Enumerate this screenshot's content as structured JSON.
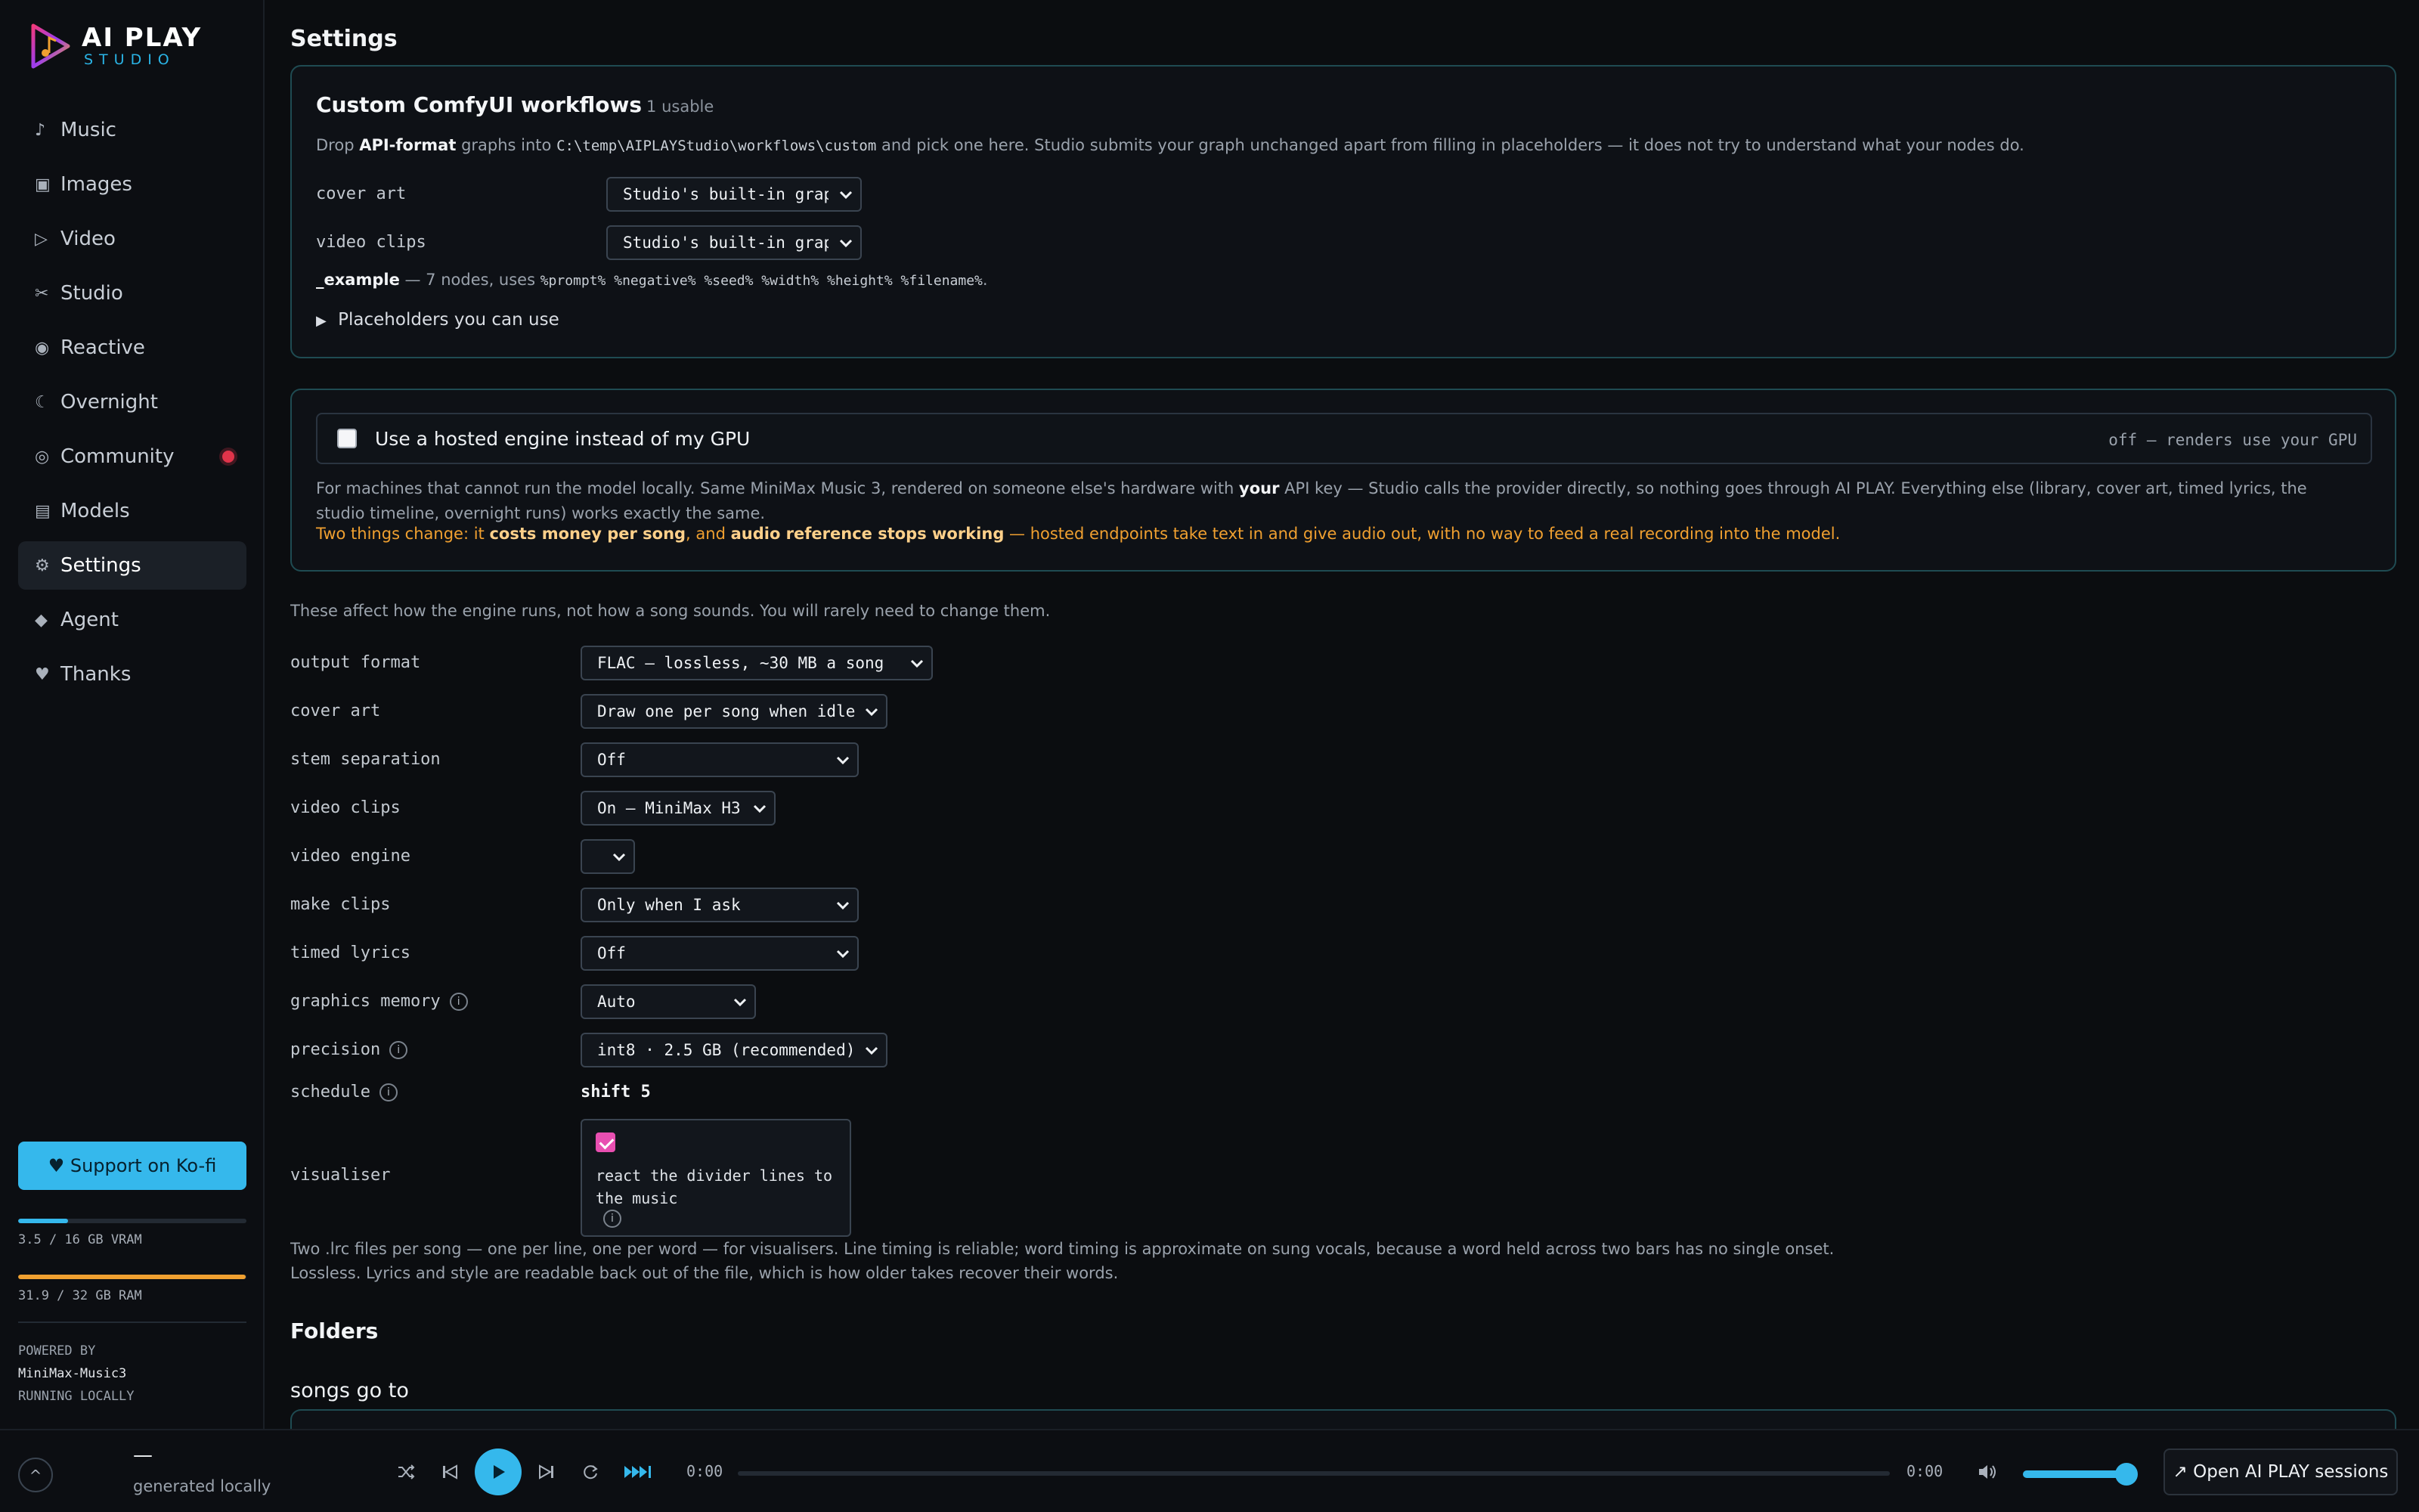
{
  "brand": {
    "title": "AI PLAY",
    "subtitle": "STUDIO"
  },
  "sidebar": {
    "items": [
      {
        "label": "Music",
        "icon": "music-note-icon",
        "glyph": "♪"
      },
      {
        "label": "Images",
        "icon": "image-icon",
        "glyph": "▣"
      },
      {
        "label": "Video",
        "icon": "play-outline-icon",
        "glyph": "▷"
      },
      {
        "label": "Studio",
        "icon": "scissors-icon",
        "glyph": "✂"
      },
      {
        "label": "Reactive",
        "icon": "radar-icon",
        "glyph": "◉"
      },
      {
        "label": "Overnight",
        "icon": "moon-icon",
        "glyph": "☾"
      },
      {
        "label": "Community",
        "icon": "community-icon",
        "glyph": "◎"
      },
      {
        "label": "Models",
        "icon": "models-icon",
        "glyph": "▤"
      },
      {
        "label": "Settings",
        "icon": "gear-icon",
        "glyph": "⚙"
      },
      {
        "label": "Agent",
        "icon": "diamond-icon",
        "glyph": "◆"
      },
      {
        "label": "Thanks",
        "icon": "heart-icon",
        "glyph": "♥"
      }
    ],
    "active": "Settings",
    "kofi_label": "♥ Support on Ko-fi",
    "vram": {
      "text": "3.5 / 16 GB VRAM",
      "fraction": 0.22,
      "color": "#35b8ec"
    },
    "ram": {
      "text": "31.9 / 32 GB RAM",
      "fraction": 0.997,
      "color": "#f0a030"
    },
    "powered_by": "POWERED BY",
    "model": "MiniMax-Music3",
    "running": "RUNNING LOCALLY"
  },
  "page": {
    "title": "Settings"
  },
  "comfy": {
    "title": "Custom ComfyUI workflows",
    "count": "1 usable",
    "desc_pre": "Drop ",
    "desc_bold": "API-format",
    "desc_mid": " graphs into ",
    "desc_path": "C:\\temp\\AIPLAYStudio\\workflows\\custom",
    "desc_post": " and pick one here. Studio submits your graph unchanged apart from filling in placeholders — it does not try to understand what your nodes do.",
    "rows": [
      {
        "label": "cover art",
        "value": "Studio's built-in graph"
      },
      {
        "label": "video clips",
        "value": "Studio's built-in graph"
      }
    ],
    "example_name": "_example",
    "example_pre": " — 7 nodes, uses ",
    "example_placeholders": "%prompt% %negative% %seed% %width% %height% %filename%",
    "example_post": ".",
    "placeholders_label": "Placeholders you can use"
  },
  "hosted": {
    "label": "Use a hosted engine instead of my GPU",
    "status": "off — renders use your GPU",
    "checked": false,
    "desc_pre": "For machines that cannot run the model locally. Same MiniMax Music 3, rendered on someone else's hardware with ",
    "desc_bold": "your",
    "desc_post": " API key — Studio calls the provider directly, so nothing goes through AI PLAY. Everything else (library, cover art, timed lyrics, the studio timeline, overnight runs) works exactly the same.",
    "warn_a": "Two things change: it ",
    "warn_b": "costs money per song",
    "warn_c": ", and ",
    "warn_d": "audio reference stops working",
    "warn_e": " — hosted endpoints take text in and give audio out, with no way to feed a real recording into the model."
  },
  "engine": {
    "intro": "These affect how the engine runs, not how a song sounds. You will rarely need to change them.",
    "rows": [
      {
        "label": "output format",
        "value": "FLAC — lossless, ~30 MB a song"
      },
      {
        "label": "cover art",
        "value": "Draw one per song when idle"
      },
      {
        "label": "stem separation",
        "value": "Off"
      },
      {
        "label": "video clips",
        "value": "On — MiniMax H3"
      },
      {
        "label": "video engine",
        "value": ""
      },
      {
        "label": "make clips",
        "value": "Only when I ask"
      },
      {
        "label": "timed lyrics",
        "value": "Off"
      },
      {
        "label": "graphics memory",
        "value": "Auto"
      },
      {
        "label": "precision",
        "value": "int8 · 2.5 GB (recommended)"
      }
    ],
    "schedule_label": "schedule",
    "schedule_value": "shift 5",
    "visualiser_label": "visualiser",
    "visualiser_text": "react the divider lines to the music",
    "visualiser_checked": true,
    "note_lyrics": "Two .lrc files per song — one per line, one per word — for visualisers. Line timing is reliable; word timing is approximate on sung vocals, because a word held across two bars has no single onset.",
    "note_format": "Lossless. Lyrics and style are readable back out of the file, which is how older takes recover their words."
  },
  "folders": {
    "title": "Folders",
    "songs_go_to": "songs go to"
  },
  "player": {
    "title": "—",
    "subtitle": "generated locally",
    "time_current": "0:00",
    "time_total": "0:00",
    "progress": 0,
    "volume": 0.95,
    "sessions_label": "↗ Open AI PLAY sessions"
  },
  "colors": {
    "accent": "#35b8ec",
    "warning": "#f0a030",
    "alert": "#e0344a",
    "check": "#e84fb1"
  }
}
